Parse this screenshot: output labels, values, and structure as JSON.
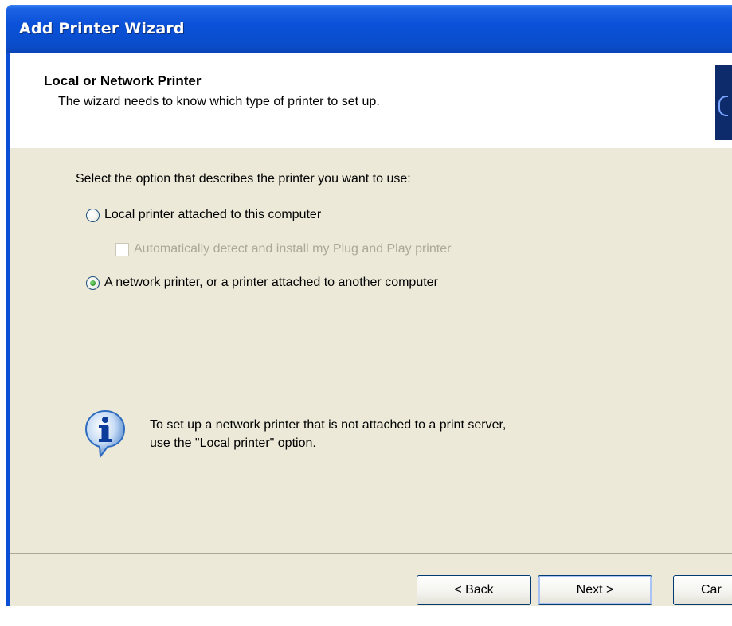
{
  "window": {
    "title": "Add Printer Wizard"
  },
  "header": {
    "title": "Local or Network Printer",
    "subtitle": "The wizard needs to know which type of printer to set up."
  },
  "body": {
    "prompt": "Select the option that describes the printer you want to use:",
    "options": {
      "local": {
        "label": "Local printer attached to this computer",
        "selected": false
      },
      "auto_detect": {
        "label": "Automatically detect and install my Plug and Play printer",
        "checked": false,
        "disabled": true
      },
      "network": {
        "label": "A network printer, or a printer attached to another computer",
        "selected": true
      }
    },
    "info": {
      "line1": "To set up a network printer that is not attached to a print server,",
      "line2": "use the \"Local printer\" option."
    }
  },
  "buttons": {
    "back": "< Back",
    "next": "Next >",
    "cancel": "Car"
  },
  "colors": {
    "titlebar": "#0a4fd6",
    "dialog_bg": "#ece9d8",
    "radio_selected_dot": "#3aa536",
    "disabled_text": "#aca899"
  }
}
